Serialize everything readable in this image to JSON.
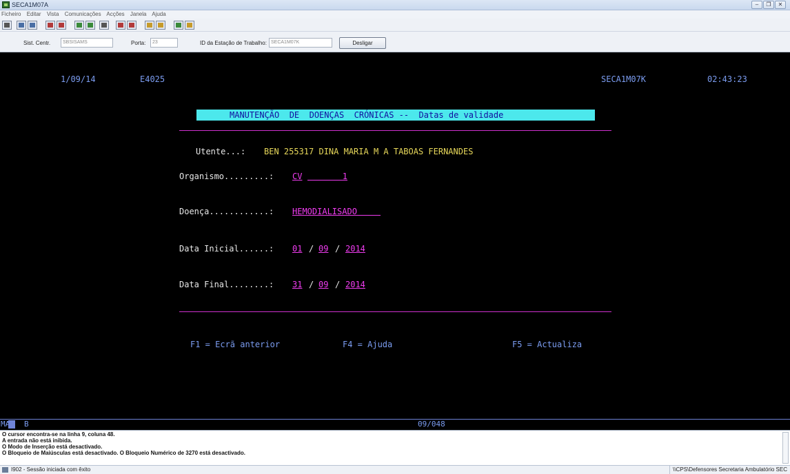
{
  "window": {
    "title": "SECA1M07A",
    "controls": [
      "minimize",
      "restore",
      "close"
    ]
  },
  "menu": [
    "Ficheiro",
    "Editar",
    "Vista",
    "Comunicações",
    "Acções",
    "Janela",
    "Ajuda"
  ],
  "connection": {
    "central_label": "Sist. Centr.",
    "central_value": "SBSISAMS",
    "port_label": "Porta:",
    "port_value": "23",
    "station_label": "ID da Estação de Trabalho:",
    "station_value": "SECA1M07K",
    "disconnect_button": "Desligar"
  },
  "screen": {
    "date": "1/09/14",
    "code": "E4025",
    "station": "SECA1M07K",
    "time": "02:43:23",
    "title": "MANUTENÇÃO  DE  DOENÇAS  CRÓNICAS --  Datas de validade",
    "utente_label": "Utente...:",
    "utente_value": "BEN 255317 DINA MARIA M A TABOAS FERNANDES",
    "organismo_label": "Organismo.........:",
    "organismo_value1": "CV",
    "organismo_value2": "1",
    "doenca_label": "Doença............:",
    "doenca_value": "HEMODIALISADO",
    "data_inicial_label": "Data Inicial......:",
    "data_inicial_day": "01",
    "data_inicial_month": "09",
    "data_inicial_year": "2014",
    "data_final_label": "Data Final........:",
    "data_final_day": "31",
    "data_final_month": "09",
    "data_final_year": "2014",
    "date_separator": "/",
    "f1": "F1 = Ecrã anterior",
    "f4": "F4 = Ajuda",
    "f5": "F5 = Actualiza"
  },
  "oia": {
    "mode": "MA",
    "b": "B",
    "cursor": "09/048"
  },
  "messages": [
    "O cursor encontra-se na linha 9, coluna 48.",
    "A entrada não está inibida.",
    "O Modo de Inserção está desactivado.",
    "O Bloqueio de Maiúsculas está desactivado. O Bloqueio Numérico de 3270 está desactivado."
  ],
  "status": {
    "left": "I902 - Sessão iniciada com êxito",
    "right": "\\\\CPS\\Defensores Secretaria Ambulatório SEC"
  },
  "colors": {
    "terminal_bg": "#000000",
    "field_blue": "#7b9cf0",
    "field_yellow": "#e8d85a",
    "input_magenta": "#f03cf0",
    "title_bar_cyan": "#4ce8ec"
  }
}
